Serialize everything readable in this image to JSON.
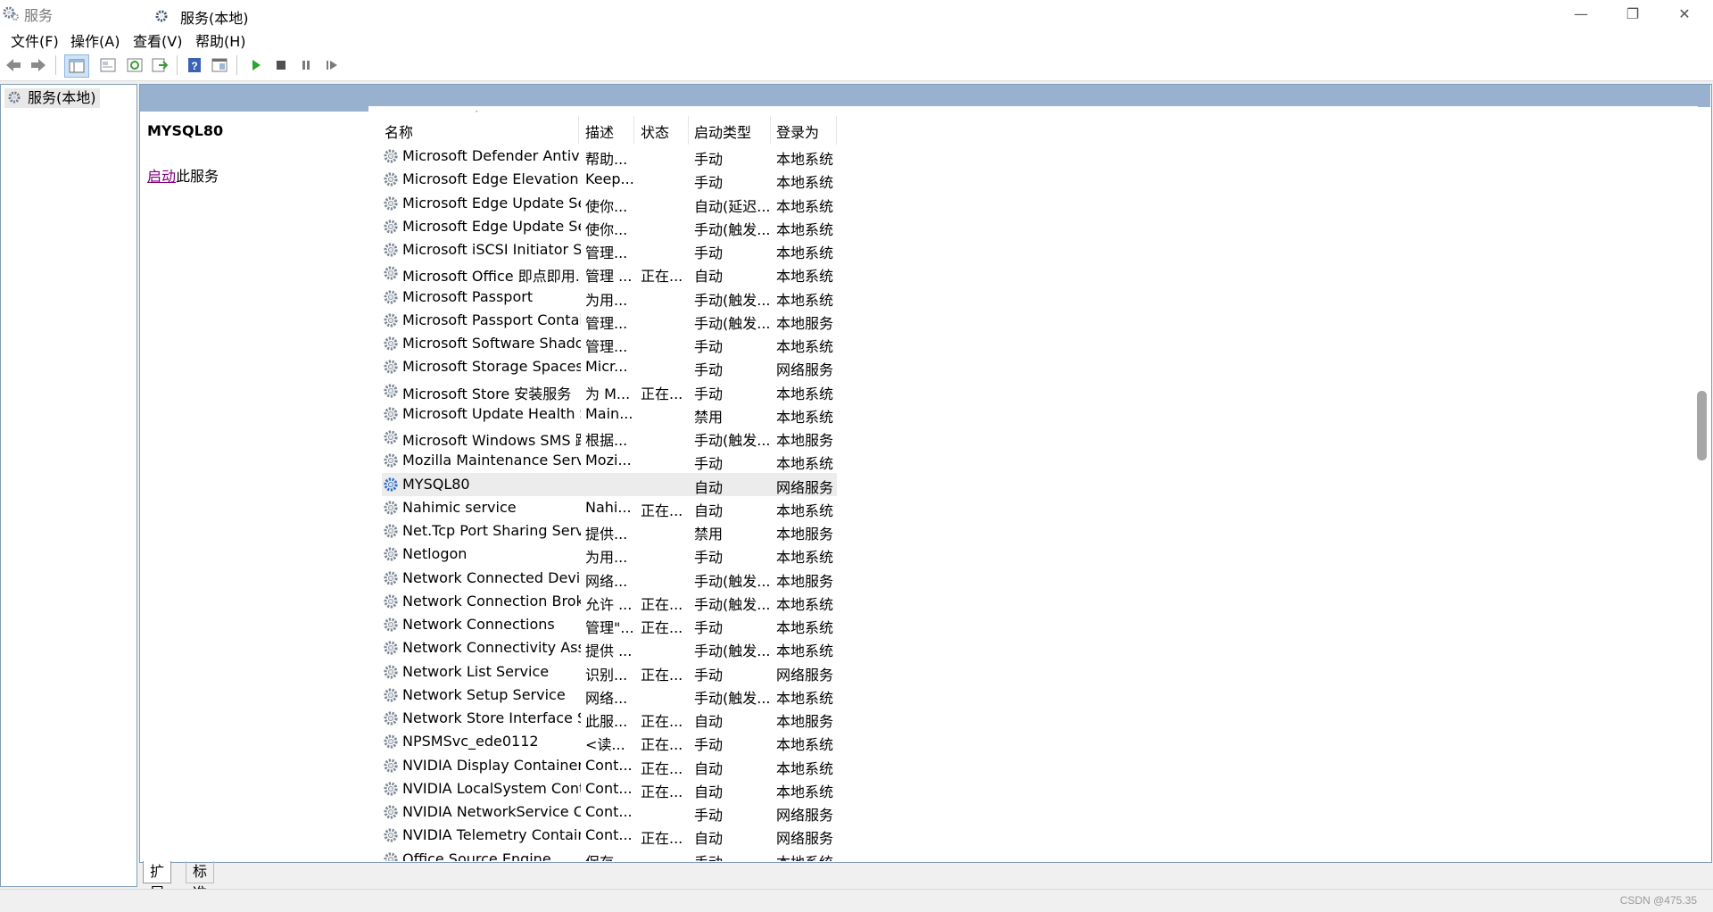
{
  "window": {
    "title": "服务",
    "title_icon": "gears-icon",
    "minimize": "—",
    "restore": "❐",
    "close": "✕"
  },
  "menu": [
    "文件(F)",
    "操作(A)",
    "查看(V)",
    "帮助(H)"
  ],
  "toolbar": {
    "icons": [
      "back-arrow-icon",
      "forward-arrow-icon",
      "show-tree-icon",
      "properties-icon",
      "refresh-icon",
      "export-list-icon",
      "help-icon",
      "view-icon",
      "start-icon",
      "stop-icon",
      "pause-icon",
      "resume-icon"
    ]
  },
  "tree": {
    "label": "服务(本地)"
  },
  "panel": {
    "header": "服务(本地)"
  },
  "detail": {
    "name": "MYSQL80",
    "start_link": "启动",
    "start_suffix": "此服务"
  },
  "columns": {
    "name": "名称",
    "desc": "描述",
    "state": "状态",
    "type": "启动类型",
    "logon": "登录为",
    "sort_arrow": "ˆ"
  },
  "rows": [
    {
      "name": "Microsoft Defender Antivir...",
      "desc": "帮助...",
      "state": "",
      "type": "手动",
      "logon": "本地系统"
    },
    {
      "name": "Microsoft Edge Elevation S...",
      "desc": "Keep...",
      "state": "",
      "type": "手动",
      "logon": "本地系统"
    },
    {
      "name": "Microsoft Edge Update Ser...",
      "desc": "使你...",
      "state": "",
      "type": "自动(延迟...",
      "logon": "本地系统"
    },
    {
      "name": "Microsoft Edge Update Ser...",
      "desc": "使你...",
      "state": "",
      "type": "手动(触发...",
      "logon": "本地系统"
    },
    {
      "name": "Microsoft iSCSI Initiator Ser...",
      "desc": "管理...",
      "state": "",
      "type": "手动",
      "logon": "本地系统"
    },
    {
      "name": "Microsoft Office 即点即用...",
      "desc": "管理 ...",
      "state": "正在...",
      "type": "自动",
      "logon": "本地系统"
    },
    {
      "name": "Microsoft Passport",
      "desc": "为用...",
      "state": "",
      "type": "手动(触发...",
      "logon": "本地系统"
    },
    {
      "name": "Microsoft Passport Container",
      "desc": "管理...",
      "state": "",
      "type": "手动(触发...",
      "logon": "本地服务"
    },
    {
      "name": "Microsoft Software Shado...",
      "desc": "管理...",
      "state": "",
      "type": "手动",
      "logon": "本地系统"
    },
    {
      "name": "Microsoft Storage Spaces S...",
      "desc": "Micr...",
      "state": "",
      "type": "手动",
      "logon": "网络服务"
    },
    {
      "name": "Microsoft Store 安装服务",
      "desc": "为 M...",
      "state": "正在...",
      "type": "手动",
      "logon": "本地系统"
    },
    {
      "name": "Microsoft Update Health S...",
      "desc": "Main...",
      "state": "",
      "type": "禁用",
      "logon": "本地系统"
    },
    {
      "name": "Microsoft Windows SMS 路...",
      "desc": "根据...",
      "state": "",
      "type": "手动(触发...",
      "logon": "本地服务"
    },
    {
      "name": "Mozilla Maintenance Service",
      "desc": "Mozi...",
      "state": "",
      "type": "手动",
      "logon": "本地系统"
    },
    {
      "name": "MYSQL80",
      "desc": "",
      "state": "",
      "type": "自动",
      "logon": "网络服务",
      "selected": true
    },
    {
      "name": "Nahimic service",
      "desc": "Nahi...",
      "state": "正在...",
      "type": "自动",
      "logon": "本地系统"
    },
    {
      "name": "Net.Tcp Port Sharing Service",
      "desc": "提供...",
      "state": "",
      "type": "禁用",
      "logon": "本地服务"
    },
    {
      "name": "Netlogon",
      "desc": "为用...",
      "state": "",
      "type": "手动",
      "logon": "本地系统"
    },
    {
      "name": "Network Connected Devic...",
      "desc": "网络...",
      "state": "",
      "type": "手动(触发...",
      "logon": "本地服务"
    },
    {
      "name": "Network Connection Broker",
      "desc": "允许 ...",
      "state": "正在...",
      "type": "手动(触发...",
      "logon": "本地系统"
    },
    {
      "name": "Network Connections",
      "desc": "管理\"...",
      "state": "正在...",
      "type": "手动",
      "logon": "本地系统"
    },
    {
      "name": "Network Connectivity Assis...",
      "desc": "提供 ...",
      "state": "",
      "type": "手动(触发...",
      "logon": "本地系统"
    },
    {
      "name": "Network List Service",
      "desc": "识别...",
      "state": "正在...",
      "type": "手动",
      "logon": "网络服务"
    },
    {
      "name": "Network Setup Service",
      "desc": "网络...",
      "state": "",
      "type": "手动(触发...",
      "logon": "本地系统"
    },
    {
      "name": "Network Store Interface Se...",
      "desc": "此服...",
      "state": "正在...",
      "type": "自动",
      "logon": "本地服务"
    },
    {
      "name": "NPSMSvc_ede0112",
      "desc": "<读...",
      "state": "正在...",
      "type": "手动",
      "logon": "本地系统"
    },
    {
      "name": "NVIDIA Display Container LS",
      "desc": "Cont...",
      "state": "正在...",
      "type": "自动",
      "logon": "本地系统"
    },
    {
      "name": "NVIDIA LocalSystem Conta...",
      "desc": "Cont...",
      "state": "正在...",
      "type": "自动",
      "logon": "本地系统"
    },
    {
      "name": "NVIDIA NetworkService C...",
      "desc": "Cont...",
      "state": "",
      "type": "手动",
      "logon": "网络服务"
    },
    {
      "name": "NVIDIA Telemetry Container",
      "desc": "Cont...",
      "state": "正在...",
      "type": "自动",
      "logon": "网络服务"
    },
    {
      "name": "Office  Source Engine",
      "desc": "保存...",
      "state": "",
      "type": "手动",
      "logon": "本地系统"
    }
  ],
  "tabs": {
    "extended": "扩展",
    "standard": "标准"
  },
  "watermark": "CSDN @475.35"
}
